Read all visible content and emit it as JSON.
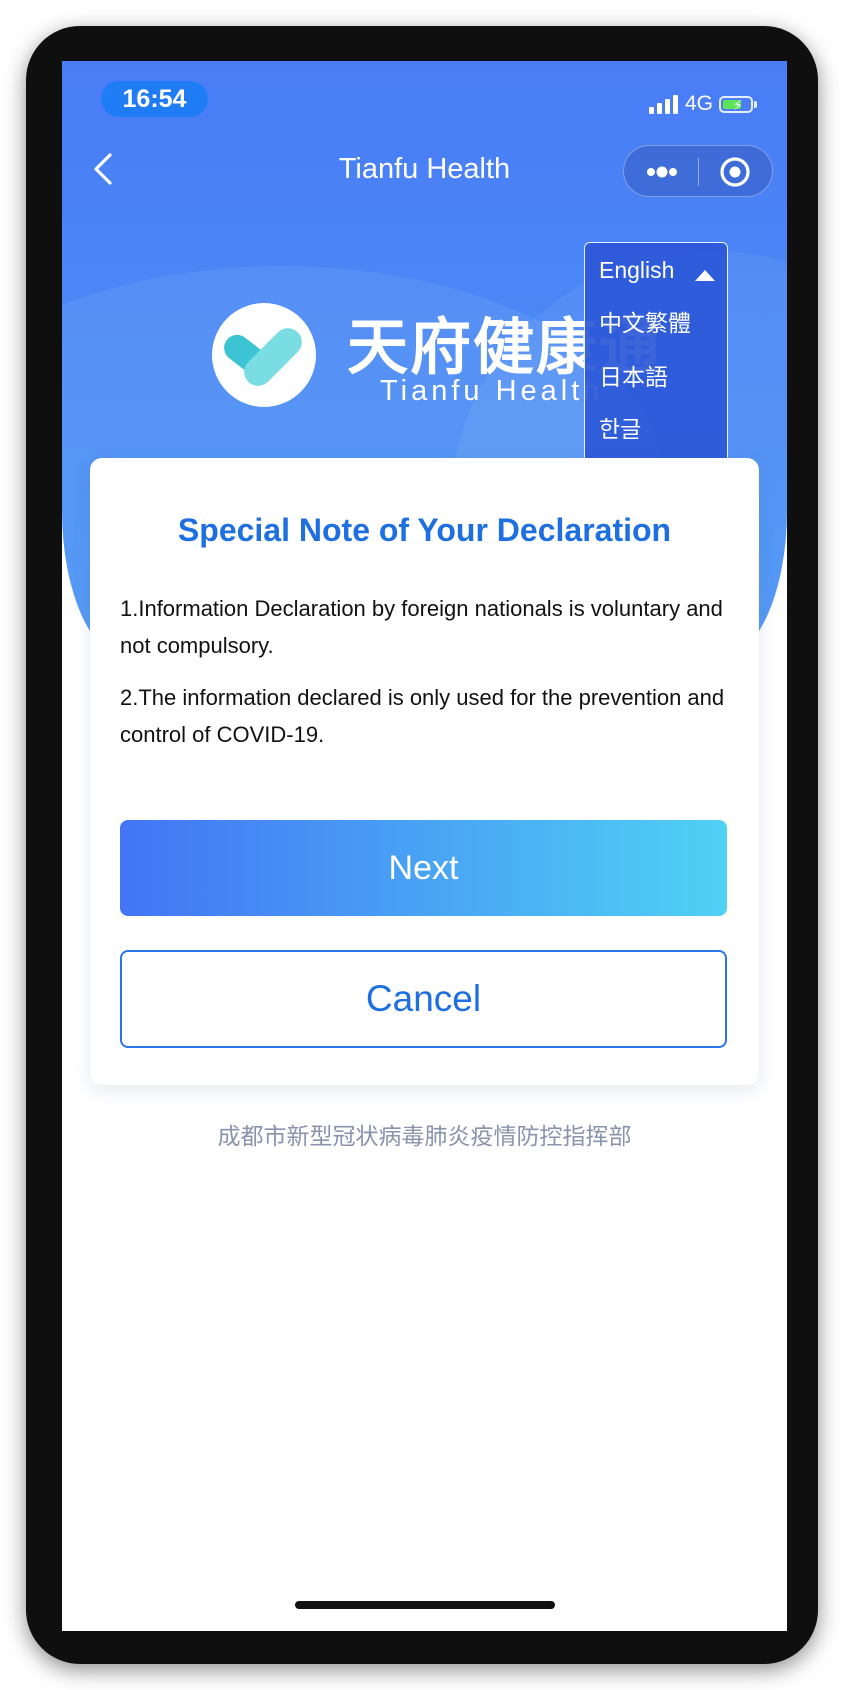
{
  "status_bar": {
    "time": "16:54",
    "network": "4G"
  },
  "nav": {
    "title": "Tianfu Health"
  },
  "brand": {
    "name_cn": "天府健康通",
    "name_en": "Tianfu Health"
  },
  "language_menu": {
    "selected": "English",
    "options": [
      "中文繁體",
      "日本語",
      "한글"
    ]
  },
  "card": {
    "title": "Special Note of Your Declaration",
    "notes": [
      "1.Information Declaration by foreign nationals is voluntary and not compulsory.",
      "2.The information declared is only used for the prevention and control of COVID-19."
    ],
    "next_label": "Next",
    "cancel_label": "Cancel"
  },
  "footer": {
    "text": "成都市新型冠状病毒肺炎疫情防控指挥部"
  },
  "colors": {
    "header_blue": "#4a7cf6",
    "title_blue": "#1e6fe2",
    "button_gradient_start": "#4374f5",
    "button_gradient_end": "#4fd2f4",
    "footer_gray": "#8a93ad"
  }
}
